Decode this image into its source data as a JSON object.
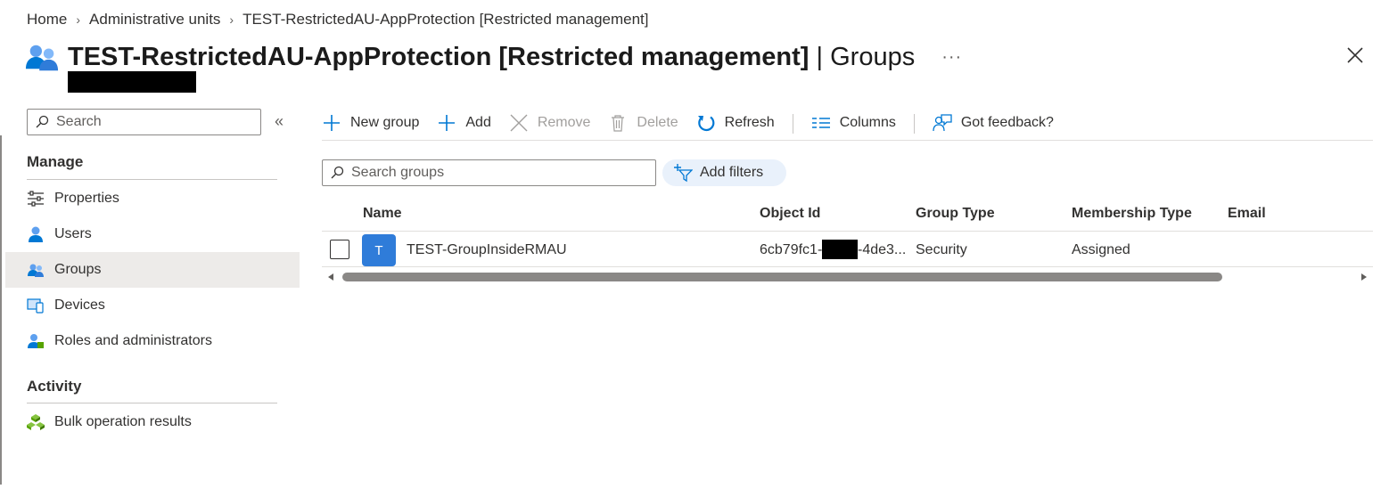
{
  "breadcrumb": {
    "items": [
      "Home",
      "Administrative units",
      "TEST-RestrictedAU-AppProtection [Restricted management]"
    ],
    "separator": ">"
  },
  "header": {
    "title": "TEST-RestrictedAU-AppProtection [Restricted management]",
    "pipe": " | ",
    "section": "Groups",
    "more": "···"
  },
  "sidebar": {
    "search_placeholder": "Search",
    "collapse": "«",
    "sections": [
      {
        "heading": "Manage",
        "items": [
          {
            "label": "Properties",
            "icon": "properties-icon"
          },
          {
            "label": "Users",
            "icon": "user-icon"
          },
          {
            "label": "Groups",
            "icon": "groups-icon",
            "active": true
          },
          {
            "label": "Devices",
            "icon": "devices-icon"
          },
          {
            "label": "Roles and administrators",
            "icon": "roles-icon"
          }
        ]
      },
      {
        "heading": "Activity",
        "items": [
          {
            "label": "Bulk operation results",
            "icon": "bulk-operations-icon"
          }
        ]
      }
    ]
  },
  "toolbar": {
    "new_group": "New group",
    "add": "Add",
    "remove": "Remove",
    "delete": "Delete",
    "refresh": "Refresh",
    "columns": "Columns",
    "feedback": "Got feedback?"
  },
  "filter": {
    "search_placeholder": "Search groups",
    "add_filters": "Add filters"
  },
  "table": {
    "columns": [
      "Name",
      "Object Id",
      "Group Type",
      "Membership Type",
      "Email"
    ],
    "rows": [
      {
        "avatar_letter": "T",
        "name": "TEST-GroupInsideRMAU",
        "object_id_prefix": "6cb79fc1-",
        "object_id_suffix": "-4de3...",
        "group_type": "Security",
        "membership_type": "Assigned",
        "email": ""
      }
    ]
  },
  "colors": {
    "accent": "#0078d4",
    "avatar": "#2f7cd9",
    "active_nav": "#edebe9",
    "filter_pill": "#e9f1fb"
  }
}
